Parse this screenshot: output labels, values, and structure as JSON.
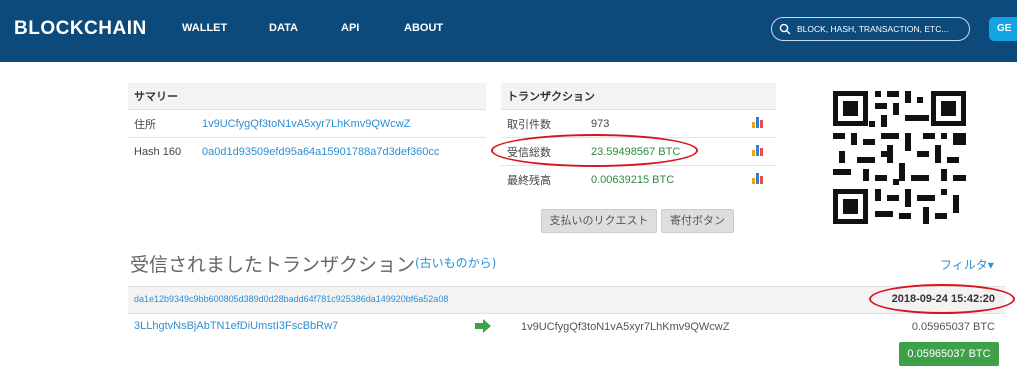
{
  "header": {
    "logo": "BLOCKCHAIN",
    "nav": [
      "WALLET",
      "DATA",
      "API",
      "ABOUT"
    ],
    "search_placeholder": "BLOCK, HASH, TRANSACTION, ETC...",
    "button_label": "GE"
  },
  "summary": {
    "title": "サマリー",
    "rows": [
      {
        "label": "住所",
        "value": "1v9UCfygQf3toN1vA5xyr7LhKmv9QWcwZ"
      },
      {
        "label": "Hash 160",
        "value": "0a0d1d93509efd95a64a15901788a7d3def360cc"
      }
    ]
  },
  "transactions_panel": {
    "title": "トランザクション",
    "rows": [
      {
        "label": "取引件数",
        "value": "973"
      },
      {
        "label": "受信総数",
        "value": "23.59498567 BTC"
      },
      {
        "label": "最終残高",
        "value": "0.00639215 BTC"
      }
    ]
  },
  "buttons": {
    "request_payment": "支払いのリクエスト",
    "donate_button": "寄付ボタン"
  },
  "received": {
    "title": "受信されましたトランザクション",
    "oldest_link": "(古いものから)",
    "filter": "フィルタ▾"
  },
  "tx": {
    "hash": "da1e12b9349c9bb600805d389d0d28badd64f781c925386da149920bf6a52a08",
    "date": "2018-09-24 15:42:20",
    "from": "3LLhgtvNsBjAbTN1efDiUmstI3FscBbRw7",
    "to": "1v9UCfygQf3toN1vA5xyr7LhKmv9QWcwZ",
    "amount": "0.05965037 BTC",
    "total": "0.05965037 BTC"
  },
  "colors": {
    "header": "#0d4a7c",
    "link": "#2b8fd3",
    "green": "#2e8b3e",
    "annotation": "#d8151b"
  }
}
